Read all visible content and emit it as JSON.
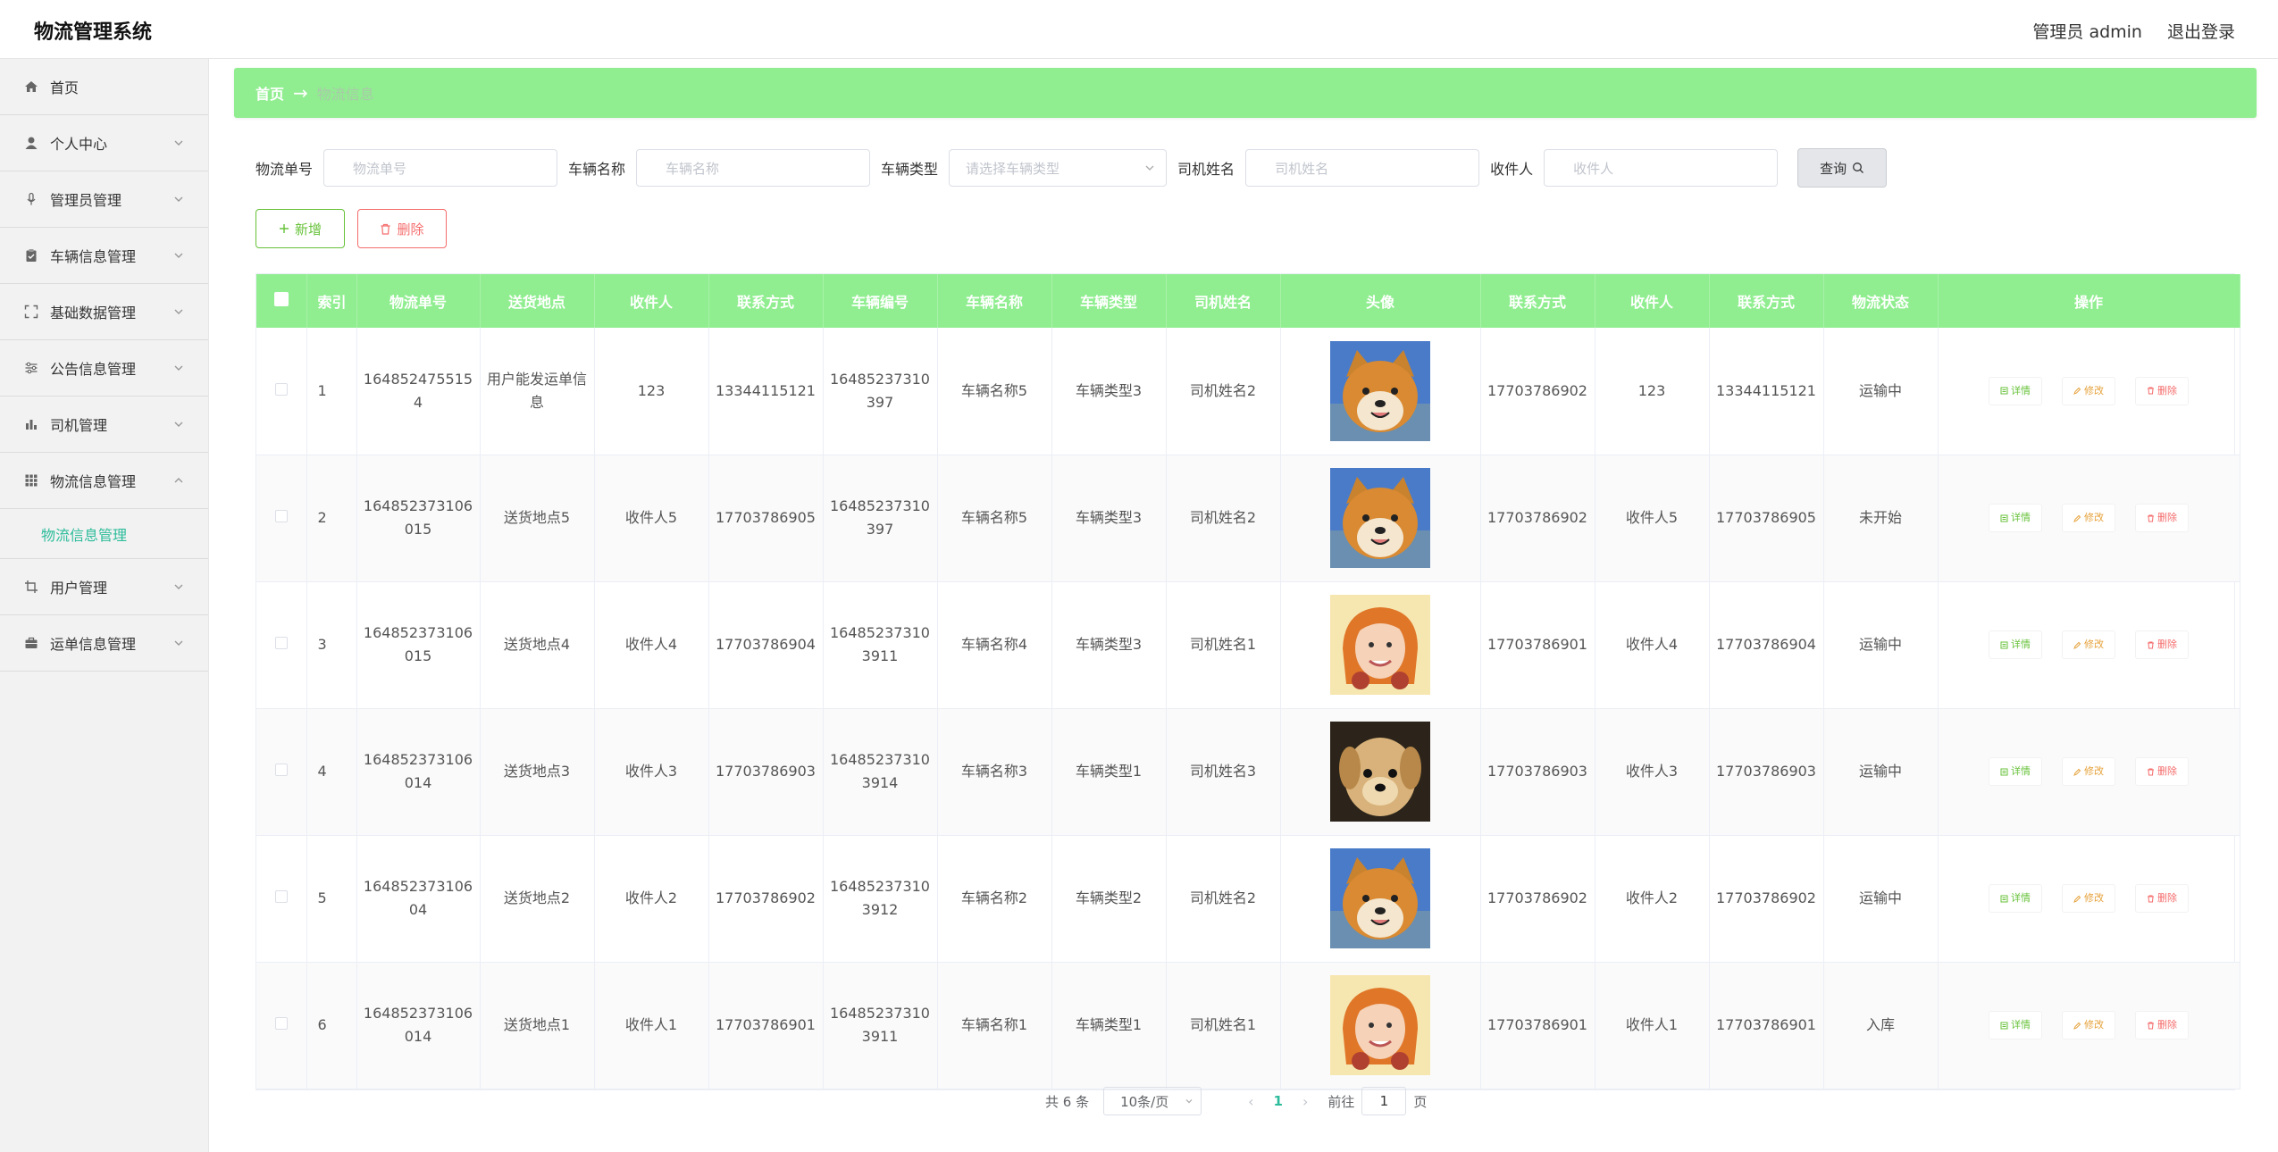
{
  "app": {
    "title": "物流管理系统",
    "user_label": "管理员 admin",
    "logout_label": "退出登录"
  },
  "sidebar": {
    "items": [
      {
        "label": "首页",
        "icon": "home-icon",
        "expandable": false
      },
      {
        "label": "个人中心",
        "icon": "user-icon",
        "expandable": true
      },
      {
        "label": "管理员管理",
        "icon": "microphone-icon",
        "expandable": true
      },
      {
        "label": "车辆信息管理",
        "icon": "clipboard-icon",
        "expandable": true
      },
      {
        "label": "基础数据管理",
        "icon": "fullscreen-icon",
        "expandable": true
      },
      {
        "label": "公告信息管理",
        "icon": "sliders-icon",
        "expandable": true
      },
      {
        "label": "司机管理",
        "icon": "bar-chart-icon",
        "expandable": true
      },
      {
        "label": "物流信息管理",
        "icon": "grid-icon",
        "expandable": true,
        "expanded": true
      },
      {
        "label": "用户管理",
        "icon": "crop-icon",
        "expandable": true
      },
      {
        "label": "运单信息管理",
        "icon": "briefcase-icon",
        "expandable": true
      }
    ],
    "active_sub": "物流信息管理",
    "active_color": "#2dbc9b"
  },
  "breadcrumb": {
    "home": "首页",
    "arrow": "→",
    "current": "物流信息"
  },
  "filters": {
    "order_no": {
      "label": "物流单号",
      "placeholder": "物流单号"
    },
    "vehicle_name": {
      "label": "车辆名称",
      "placeholder": "车辆名称"
    },
    "vehicle_type": {
      "label": "车辆类型",
      "placeholder": "请选择车辆类型"
    },
    "driver_name": {
      "label": "司机姓名",
      "placeholder": "司机姓名"
    },
    "receiver": {
      "label": "收件人",
      "placeholder": "收件人"
    },
    "query_label": "查询"
  },
  "actions": {
    "add_label": "新增",
    "delete_label": "删除"
  },
  "table": {
    "header_color": "#90ee90",
    "columns": [
      "索引",
      "物流单号",
      "送货地点",
      "收件人",
      "联系方式",
      "车辆编号",
      "车辆名称",
      "车辆类型",
      "司机姓名",
      "头像",
      "联系方式",
      "收件人",
      "联系方式",
      "物流状态",
      "操作"
    ],
    "ops": {
      "detail": "详情",
      "edit": "修改",
      "remove": "删除"
    },
    "rows": [
      {
        "index": "1",
        "order_no": "1648524755154",
        "address": "用户能发运单信息",
        "receiver": "123",
        "phone": "13344115121",
        "vehicle_no": "16485237310397",
        "vehicle_name": "车辆名称5",
        "vehicle_type": "车辆类型3",
        "driver": "司机姓名2",
        "avatar": "shiba-dog",
        "driver_phone": "17703786902",
        "receiver2": "123",
        "phone2": "13344115121",
        "status": "运输中"
      },
      {
        "index": "2",
        "order_no": "164852373106015",
        "address": "送货地点5",
        "receiver": "收件人5",
        "phone": "17703786905",
        "vehicle_no": "16485237310397",
        "vehicle_name": "车辆名称5",
        "vehicle_type": "车辆类型3",
        "driver": "司机姓名2",
        "avatar": "shiba-dog",
        "driver_phone": "17703786902",
        "receiver2": "收件人5",
        "phone2": "17703786905",
        "status": "未开始"
      },
      {
        "index": "3",
        "order_no": "164852373106015",
        "address": "送货地点4",
        "receiver": "收件人4",
        "phone": "17703786904",
        "vehicle_no": "164852373103911",
        "vehicle_name": "车辆名称4",
        "vehicle_type": "车辆类型3",
        "driver": "司机姓名1",
        "avatar": "smiling-woman",
        "driver_phone": "17703786901",
        "receiver2": "收件人4",
        "phone2": "17703786904",
        "status": "运输中"
      },
      {
        "index": "4",
        "order_no": "164852373106014",
        "address": "送货地点3",
        "receiver": "收件人3",
        "phone": "17703786903",
        "vehicle_no": "164852373103914",
        "vehicle_name": "车辆名称3",
        "vehicle_type": "车辆类型1",
        "driver": "司机姓名3",
        "avatar": "puppy",
        "driver_phone": "17703786903",
        "receiver2": "收件人3",
        "phone2": "17703786903",
        "status": "运输中"
      },
      {
        "index": "5",
        "order_no": "16485237310604",
        "address": "送货地点2",
        "receiver": "收件人2",
        "phone": "17703786902",
        "vehicle_no": "164852373103912",
        "vehicle_name": "车辆名称2",
        "vehicle_type": "车辆类型2",
        "driver": "司机姓名2",
        "avatar": "shiba-dog",
        "driver_phone": "17703786902",
        "receiver2": "收件人2",
        "phone2": "17703786902",
        "status": "运输中"
      },
      {
        "index": "6",
        "order_no": "164852373106014",
        "address": "送货地点1",
        "receiver": "收件人1",
        "phone": "17703786901",
        "vehicle_no": "164852373103911",
        "vehicle_name": "车辆名称1",
        "vehicle_type": "车辆类型1",
        "driver": "司机姓名1",
        "avatar": "smiling-woman",
        "driver_phone": "17703786901",
        "receiver2": "收件人1",
        "phone2": "17703786901",
        "status": "入库"
      }
    ]
  },
  "pagination": {
    "total_text": "共 6 条",
    "page_size": "10条/页",
    "current_page": "1",
    "goto_label": "前往",
    "goto_value": "1",
    "page_unit": "页"
  }
}
